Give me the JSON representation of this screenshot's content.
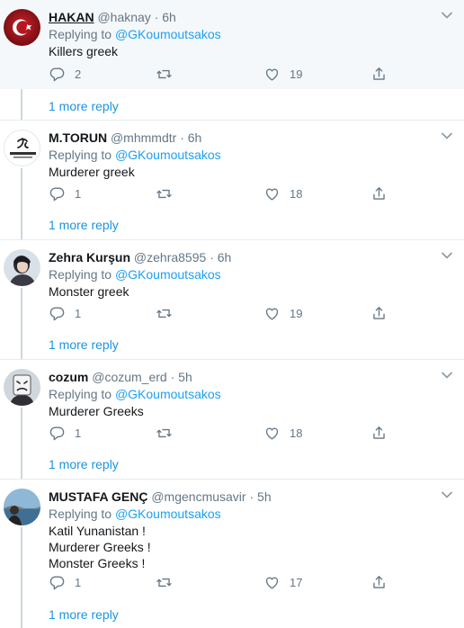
{
  "replies": [
    {
      "display_name": "HAKAN",
      "handle": "@haknay",
      "time": "6h",
      "replying_label": "Replying to",
      "replying_to": "@GKoumoutsakos",
      "lines": [
        "Killers greek"
      ],
      "reply_count": "2",
      "retweet_count": "",
      "like_count": "19",
      "more_replies": "1 more reply",
      "avatar_icon": "turkish-flag-avatar"
    },
    {
      "display_name": "M.TORUN",
      "handle": "@mhmmdtr",
      "time": "6h",
      "replying_label": "Replying to",
      "replying_to": "@GKoumoutsakos",
      "lines": [
        "Murderer greek"
      ],
      "reply_count": "1",
      "retweet_count": "",
      "like_count": "18",
      "more_replies": "1 more reply",
      "avatar_icon": "calligraphy-logo-avatar"
    },
    {
      "display_name": "Zehra Kurşun",
      "handle": "@zehra8595",
      "time": "6h",
      "replying_label": "Replying to",
      "replying_to": "@GKoumoutsakos",
      "lines": [
        "Monster greek"
      ],
      "reply_count": "1",
      "retweet_count": "",
      "like_count": "19",
      "more_replies": "1 more reply",
      "avatar_icon": "photo-avatar"
    },
    {
      "display_name": "cozum",
      "handle": "@cozum_erd",
      "time": "5h",
      "replying_label": "Replying to",
      "replying_to": "@GKoumoutsakos",
      "lines": [
        "Murderer Greeks"
      ],
      "reply_count": "1",
      "retweet_count": "",
      "like_count": "18",
      "more_replies": "1 more reply",
      "avatar_icon": "masked-face-avatar"
    },
    {
      "display_name": "MUSTAFA GENÇ",
      "handle": "@mgencmusavir",
      "time": "5h",
      "replying_label": "Replying to",
      "replying_to": "@GKoumoutsakos",
      "lines": [
        "Katil Yunanistan !",
        "Murderer Greeks !",
        "Monster Greeks !"
      ],
      "reply_count": "1",
      "retweet_count": "",
      "like_count": "17",
      "more_replies": "1 more reply",
      "avatar_icon": "landscape-photo-avatar"
    }
  ],
  "colors": {
    "link": "#1da1f2",
    "secondary_text": "#657786",
    "rail": "#ccd6dd",
    "highlight_bg": "#f5f8fa"
  }
}
